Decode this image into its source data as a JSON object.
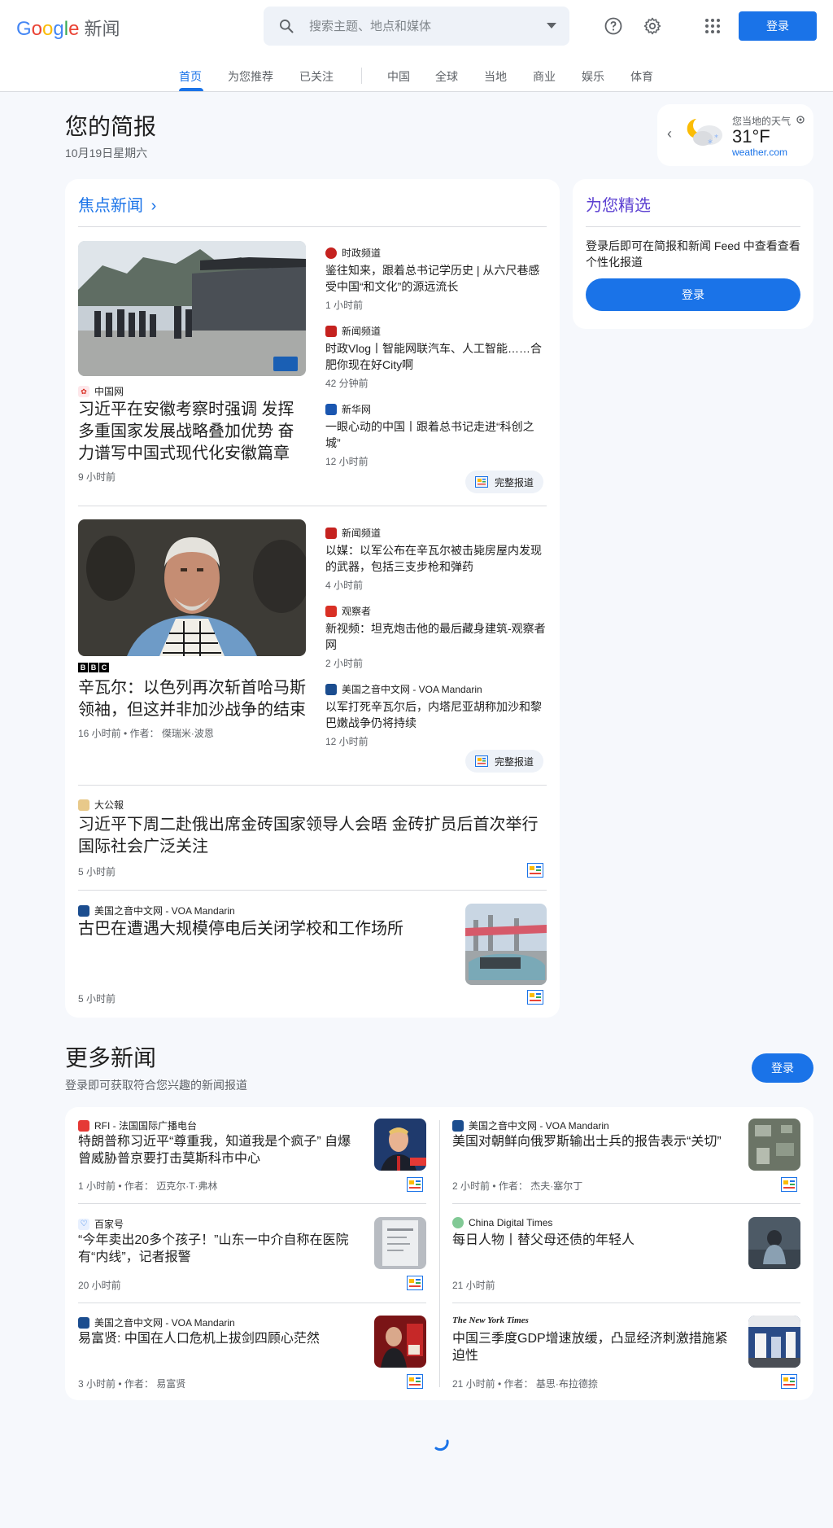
{
  "header": {
    "logo_news": "新闻",
    "search_placeholder": "搜索主题、地点和媒体",
    "signin": "登录"
  },
  "nav": {
    "items": [
      "首页",
      "为您推荐",
      "已关注",
      "中国",
      "全球",
      "当地",
      "商业",
      "娱乐",
      "体育"
    ],
    "active": "首页"
  },
  "briefing": {
    "title": "您的简报",
    "date": "10月19日星期六"
  },
  "weather": {
    "label": "您当地的天气",
    "temp": "31°F",
    "source": "weather.com"
  },
  "top_stories": {
    "title": "焦点新闻",
    "full_coverage": "完整报道",
    "cluster1": {
      "main": {
        "source": "中国网",
        "headline": "习近平在安徽考察时强调 发挥多重国家发展战略叠加优势 奋力谱写中国式现代化安徽篇章",
        "time": "9 小时前"
      },
      "side": [
        {
          "source": "时政频道",
          "headline": "鉴往知来，跟着总书记学历史 | 从六尺巷感受中国“和文化”的源远流长",
          "time": "1 小时前"
        },
        {
          "source": "新闻频道",
          "headline": "时政Vlog丨智能网联汽车、人工智能……合肥你现在好City啊",
          "time": "42 分钟前"
        },
        {
          "source": "新华网",
          "headline": "一眼心动的中国丨跟着总书记走进“科创之城”",
          "time": "12 小时前"
        }
      ]
    },
    "cluster2": {
      "main": {
        "source": "BBC",
        "headline": "辛瓦尔：以色列再次斩首哈马斯领袖，但这并非加沙战争的结束",
        "time": "16 小时前 • 作者： 傑瑞米·波恩"
      },
      "side": [
        {
          "source": "新闻频道",
          "headline": "以媒：以军公布在辛瓦尔被击毙房屋内发现的武器，包括三支步枪和弹药",
          "time": "4 小时前"
        },
        {
          "source": "观察者",
          "headline": "新视频：坦克炮击他的最后藏身建筑-观察者网",
          "time": "2 小时前"
        },
        {
          "source": "美国之音中文网 - VOA Mandarin",
          "headline": "以军打死辛瓦尔后，内塔尼亚胡称加沙和黎巴嫩战争仍将持续",
          "time": "12 小时前"
        }
      ]
    },
    "story3": {
      "source": "大公報",
      "headline": "习近平下周二赴俄出席金砖国家领导人会晤 金砖扩员后首次举行 国际社会广泛关注",
      "time": "5 小时前"
    },
    "story4": {
      "source": "美国之音中文网 - VOA Mandarin",
      "headline": "古巴在遭遇大规模停电后关闭学校和工作场所",
      "time": "5 小时前"
    }
  },
  "picks": {
    "title": "为您精选",
    "text": "登录后即可在简报和新闻 Feed 中查看查看个性化报道",
    "button": "登录"
  },
  "more_news": {
    "title": "更多新闻",
    "subtitle": "登录即可获取符合您兴趣的新闻报道",
    "button": "登录",
    "items": [
      {
        "source": "RFI - 法国国际广播电台",
        "headline": "特朗普称习近平“尊重我，知道我是个疯子” 自爆曾威胁普京要打击莫斯科市中心",
        "time": "1 小时前 • 作者： 迈克尔·T·弗林"
      },
      {
        "source": "美国之音中文网 - VOA Mandarin",
        "headline": "美国对朝鲜向俄罗斯输出士兵的报告表示“关切”",
        "time": "2 小时前 • 作者： 杰夫·塞尔丁"
      },
      {
        "source": "百家号",
        "headline": "“今年卖出20多个孩子！”山东一中介自称在医院有“内线”，记者报警",
        "time": "20 小时前"
      },
      {
        "source": "China Digital Times",
        "headline": "每日人物丨替父母还债的年轻人",
        "time": "21 小时前"
      },
      {
        "source": "美国之音中文网 - VOA Mandarin",
        "headline": "易富贤: 中国在人口危机上拔剑四顾心茫然",
        "time": "3 小时前 • 作者： 易富贤"
      },
      {
        "source": "The New York Times",
        "headline": "中国三季度GDP增速放缓，凸显经济刺激措施紧迫性",
        "time": "21 小时前 • 作者： 基思·布拉德捺"
      }
    ]
  },
  "colors": {
    "accent": "#1a73e8",
    "picks_title": "#5b3fd1",
    "background": "#f6f8fc"
  }
}
